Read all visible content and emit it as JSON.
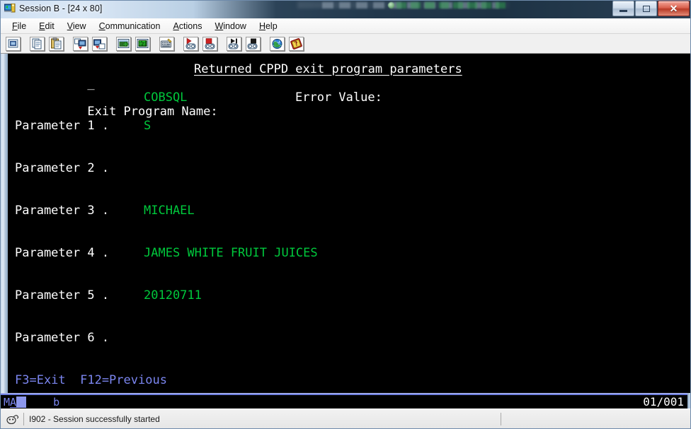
{
  "window": {
    "title": "Session B - [24 x 80]",
    "icon": "session-window-icon",
    "controls": {
      "minimize": "minimize-button",
      "maximize": "maximize-button",
      "close": "close-button",
      "close_glyph": "✕"
    }
  },
  "menu": {
    "items": [
      {
        "label": "File",
        "mnemonic": "F"
      },
      {
        "label": "Edit",
        "mnemonic": "E"
      },
      {
        "label": "View",
        "mnemonic": "V"
      },
      {
        "label": "Communication",
        "mnemonic": "C"
      },
      {
        "label": "Actions",
        "mnemonic": "A"
      },
      {
        "label": "Window",
        "mnemonic": "W"
      },
      {
        "label": "Help",
        "mnemonic": "H"
      }
    ]
  },
  "toolbar": {
    "buttons": [
      {
        "name": "display-settings-icon",
        "title": "Display Settings"
      },
      {
        "name": "copy-icon",
        "title": "Copy"
      },
      {
        "name": "paste-icon",
        "title": "Paste"
      },
      {
        "name": "send-file-icon",
        "title": "Send File to Host"
      },
      {
        "name": "receive-file-icon",
        "title": "Receive File from Host"
      },
      {
        "name": "new-session-icon",
        "title": "New Session"
      },
      {
        "name": "session-list-icon",
        "title": "Session List"
      },
      {
        "name": "keyboard-remap-icon",
        "title": "Keyboard Remap"
      },
      {
        "name": "record-macro-icon",
        "title": "Record Macro"
      },
      {
        "name": "stop-macro-icon",
        "title": "Stop Macro"
      },
      {
        "name": "play-macro-icon",
        "title": "Play Macro"
      },
      {
        "name": "stop-playback-icon",
        "title": "Stop Playback"
      },
      {
        "name": "internet-icon",
        "title": "Internet"
      },
      {
        "name": "help-book-icon",
        "title": "Help"
      }
    ]
  },
  "terminal": {
    "size": "24 x 80",
    "cursor": {
      "row": 1,
      "column": 1,
      "glyph": "_"
    },
    "colors": {
      "background": "#000000",
      "normal": "#ffffff",
      "input": "#00c83c",
      "function_keys": "#7b86f0"
    },
    "screen_title": "Returned CPPD exit program parameters",
    "fields": {
      "exit_program_label": "Exit Program Name:",
      "exit_program_value": "COBSQL",
      "error_value_label": "Error Value:",
      "error_value": ""
    },
    "parameters": [
      {
        "label": "Parameter 1 .",
        "value": "S"
      },
      {
        "label": "Parameter 2 .",
        "value": ""
      },
      {
        "label": "Parameter 3 .",
        "value": "MICHAEL"
      },
      {
        "label": "Parameter 4 .",
        "value": "JAMES WHITE FRUIT JUICES"
      },
      {
        "label": "Parameter 5 .",
        "value": "20120711"
      },
      {
        "label": "Parameter 6 .",
        "value": ""
      }
    ],
    "function_keys": "F3=Exit  F12=Previous"
  },
  "oia": {
    "system_indicator": "M",
    "attention_indicator": "A",
    "input_inhibited_block": "",
    "insert_mode": "b",
    "cursor_position": "01/001"
  },
  "statusbar": {
    "icon": "connection-icon",
    "message": "I902 - Session successfully started"
  }
}
